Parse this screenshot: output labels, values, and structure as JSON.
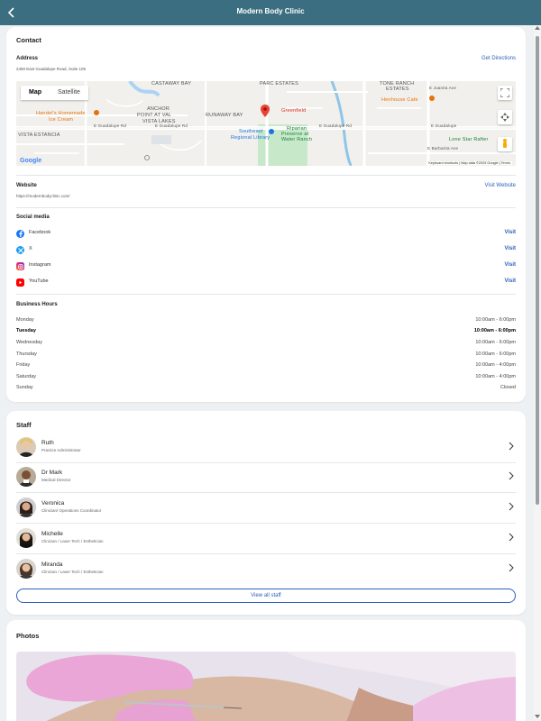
{
  "header": {
    "title": "Modern Body Clinic"
  },
  "contact": {
    "heading": "Contact",
    "address_label": "Address",
    "address": "2450 East Guadalupe Road, Suite 105",
    "directions_label": "Get Directions",
    "map": {
      "tabs": [
        "Map",
        "Satellite"
      ],
      "labels": {
        "castaway_bay": "CASTAWAY BAY",
        "parc_estates": "PARC ESTATES",
        "tone_ranch": "TONE RANCH",
        "estates": "ESTATES",
        "anchor": "ANCHOR",
        "point_at_val": "POINT AT VAL",
        "vista_lakes": "VISTA LAKES",
        "runaway_bay": "RUNAWAY BAY",
        "vista_estancia": "VISTA ESTANCIA",
        "greenfield": "Greenfield",
        "handels": "Handel's Homemade",
        "ice_cream": "Ice Cream",
        "henhouse": "Henhouse Cafe",
        "library1": "Southeast",
        "library2": "Regional Library",
        "riparian1": "Riparian",
        "riparian2": "Preserve at",
        "riparian3": "Water Ranch",
        "guadalupe1": "E Guadalupe Rd",
        "guadalupe2": "E Guadalupe Rd",
        "guadalupe3": "E Guadalupe Rd",
        "guadalupe4": "E Guadalupe",
        "lone_star": "Lone Star Rafter",
        "barbarita": "E Barbarita Ave",
        "juanita": "E Juanita Ave",
        "google": "Google",
        "footer": "Keyboard shortcuts  |  Map data ©2025 Google  |  Terms"
      }
    },
    "website_label": "Website",
    "website_url": "https://modernbodyclinic.com/",
    "website_link": "Visit Website",
    "social_heading": "Social media",
    "social": [
      {
        "name": "Facebook",
        "action": "Visit",
        "icon": "facebook-icon",
        "color": "#1877f2"
      },
      {
        "name": "X",
        "action": "Visit",
        "icon": "x-icon",
        "color": "#1d9bf0"
      },
      {
        "name": "Instagram",
        "action": "Visit",
        "icon": "instagram-icon",
        "color": "#e1306c"
      },
      {
        "name": "YouTube",
        "action": "Visit",
        "icon": "youtube-icon",
        "color": "#ff0000"
      }
    ],
    "hours_heading": "Business Hours",
    "hours": [
      {
        "day": "Monday",
        "time": "10:00am - 6:00pm",
        "today": false
      },
      {
        "day": "Tuesday",
        "time": "10:00am - 6:00pm",
        "today": true
      },
      {
        "day": "Wednesday",
        "time": "10:00am - 6:00pm",
        "today": false
      },
      {
        "day": "Thursday",
        "time": "10:00am - 6:00pm",
        "today": false
      },
      {
        "day": "Friday",
        "time": "10:00am - 4:00pm",
        "today": false
      },
      {
        "day": "Saturday",
        "time": "10:00am - 4:00pm",
        "today": false
      },
      {
        "day": "Sunday",
        "time": "Closed",
        "today": false
      }
    ]
  },
  "staff": {
    "heading": "Staff",
    "members": [
      {
        "name": "Ruth",
        "role": "Practice Administrator"
      },
      {
        "name": "Dr Mark",
        "role": "Medical Director"
      },
      {
        "name": "Veronica",
        "role": "Clinician/ Operations Coordinator"
      },
      {
        "name": "Michelle",
        "role": "Clinician / Laser Tech / Esthetician"
      },
      {
        "name": "Miranda",
        "role": "Clinician / Laser Tech / Esthetician"
      }
    ],
    "view_all": "View all staff"
  },
  "photos": {
    "heading": "Photos"
  },
  "colors": {
    "header": "#3b6e80",
    "link": "#2f5fb8",
    "background": "#eef1f3"
  }
}
